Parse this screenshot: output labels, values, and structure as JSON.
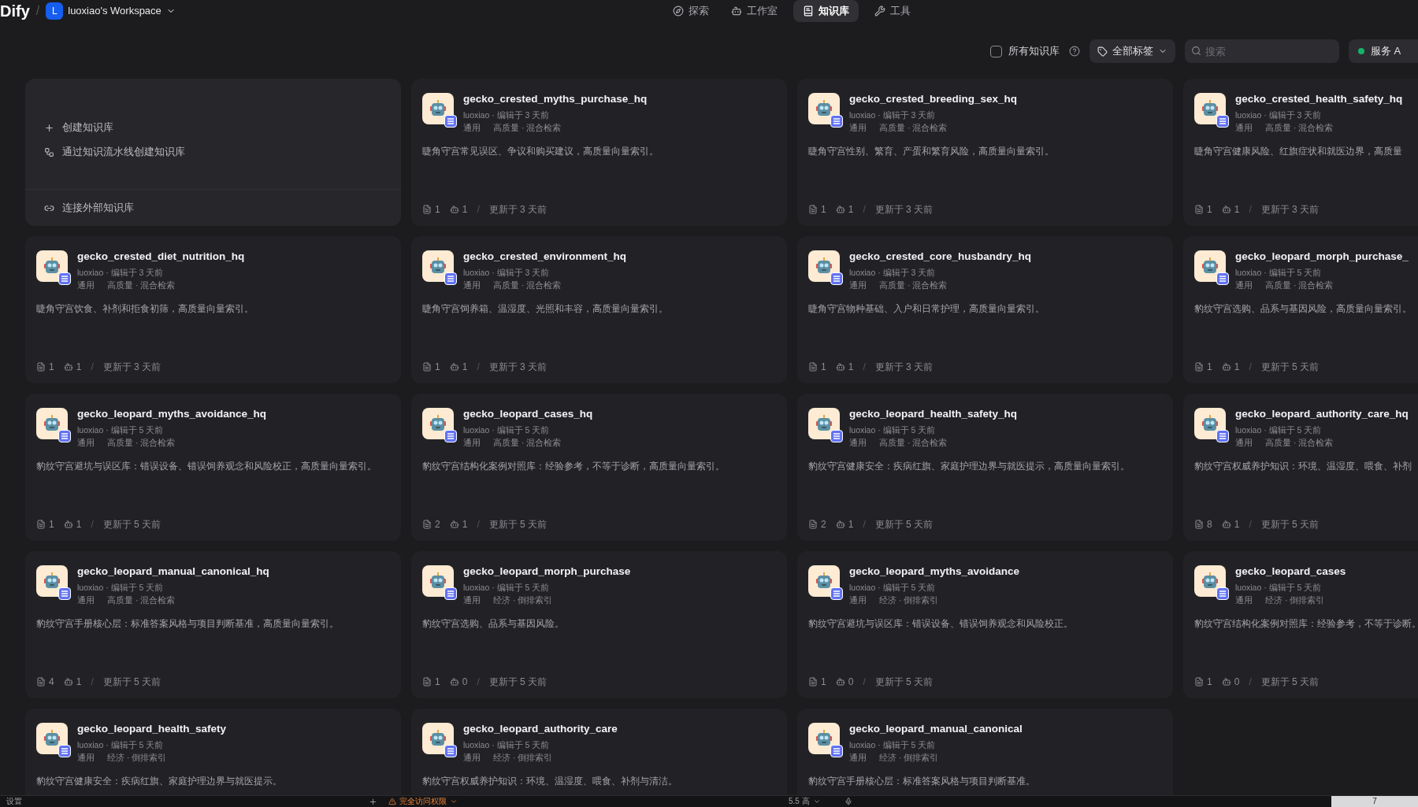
{
  "header": {
    "logo": "Dify",
    "separator": "/",
    "workspace": {
      "initial": "L",
      "name": "luoxiao's Workspace"
    },
    "nav": [
      {
        "label": "探索",
        "selected": false
      },
      {
        "label": "工作室",
        "selected": false
      },
      {
        "label": "知识库",
        "selected": true
      },
      {
        "label": "工具",
        "selected": false
      }
    ]
  },
  "toolbar": {
    "all_datasets": {
      "label": "所有知识库",
      "checked": false
    },
    "tag_filter": "全部标签",
    "search": {
      "placeholder": "搜索"
    },
    "service_button": "服务 A"
  },
  "create_card": {
    "actions": [
      "创建知识库",
      "通过知识流水线创建知识库"
    ],
    "external": "连接外部知识库"
  },
  "datasets": [
    {
      "name": "gecko_crested_myths_purchase_hq",
      "meta": "luoxiao · 编辑于 3 天前",
      "tag": "通用",
      "mode": "高质量 · 混合检索",
      "description": "睫角守宫常见误区、争议和购买建议，高质量向量索引。",
      "docs": "1",
      "apps": "1",
      "separator": "/",
      "updated": "更新于 3 天前"
    },
    {
      "name": "gecko_crested_breeding_sex_hq",
      "meta": "luoxiao · 编辑于 3 天前",
      "tag": "通用",
      "mode": "高质量 · 混合检索",
      "description": "睫角守宫性别、繁育、产蛋和繁育风险，高质量向量索引。",
      "docs": "1",
      "apps": "1",
      "separator": "/",
      "updated": "更新于 3 天前"
    },
    {
      "name": "gecko_crested_health_safety_hq",
      "meta": "luoxiao · 编辑于 3 天前",
      "tag": "通用",
      "mode": "高质量 · 混合检索",
      "description": "睫角守宫健康风险、红旗症状和就医边界，高质量",
      "docs": "1",
      "apps": "1",
      "separator": "/",
      "updated": "更新于 3 天前"
    },
    {
      "name": "gecko_crested_diet_nutrition_hq",
      "meta": "luoxiao · 编辑于 3 天前",
      "tag": "通用",
      "mode": "高质量 · 混合检索",
      "description": "睫角守宫饮食、补剂和拒食初筛，高质量向量索引。",
      "docs": "1",
      "apps": "1",
      "separator": "/",
      "updated": "更新于 3 天前"
    },
    {
      "name": "gecko_crested_environment_hq",
      "meta": "luoxiao · 编辑于 3 天前",
      "tag": "通用",
      "mode": "高质量 · 混合检索",
      "description": "睫角守宫饲养箱、温湿度、光照和丰容，高质量向量索引。",
      "docs": "1",
      "apps": "1",
      "separator": "/",
      "updated": "更新于 3 天前"
    },
    {
      "name": "gecko_crested_core_husbandry_hq",
      "meta": "luoxiao · 编辑于 3 天前",
      "tag": "通用",
      "mode": "高质量 · 混合检索",
      "description": "睫角守宫物种基础、入户和日常护理，高质量向量索引。",
      "docs": "1",
      "apps": "1",
      "separator": "/",
      "updated": "更新于 3 天前"
    },
    {
      "name": "gecko_leopard_morph_purchase_",
      "meta": "luoxiao · 编辑于 5 天前",
      "tag": "通用",
      "mode": "高质量 · 混合检索",
      "description": "豹纹守宫选购、品系与基因风险，高质量向量索引。",
      "docs": "1",
      "apps": "1",
      "separator": "/",
      "updated": "更新于 5 天前"
    },
    {
      "name": "gecko_leopard_myths_avoidance_hq",
      "meta": "luoxiao · 编辑于 5 天前",
      "tag": "通用",
      "mode": "高质量 · 混合检索",
      "description": "豹纹守宫避坑与误区库：错误设备、错误饲养观念和风险校正，高质量向量索引。",
      "docs": "1",
      "apps": "1",
      "separator": "/",
      "updated": "更新于 5 天前"
    },
    {
      "name": "gecko_leopard_cases_hq",
      "meta": "luoxiao · 编辑于 5 天前",
      "tag": "通用",
      "mode": "高质量 · 混合检索",
      "description": "豹纹守宫结构化案例对照库：经验参考，不等于诊断，高质量向量索引。",
      "docs": "2",
      "apps": "1",
      "separator": "/",
      "updated": "更新于 5 天前"
    },
    {
      "name": "gecko_leopard_health_safety_hq",
      "meta": "luoxiao · 编辑于 5 天前",
      "tag": "通用",
      "mode": "高质量 · 混合检索",
      "description": "豹纹守宫健康安全：疾病红旗、家庭护理边界与就医提示，高质量向量索引。",
      "docs": "2",
      "apps": "1",
      "separator": "/",
      "updated": "更新于 5 天前"
    },
    {
      "name": "gecko_leopard_authority_care_hq",
      "meta": "luoxiao · 编辑于 5 天前",
      "tag": "通用",
      "mode": "高质量 · 混合检索",
      "description": "豹纹守宫权威养护知识：环境、温湿度、喂食、补剂",
      "docs": "8",
      "apps": "1",
      "separator": "/",
      "updated": "更新于 5 天前"
    },
    {
      "name": "gecko_leopard_manual_canonical_hq",
      "meta": "luoxiao · 编辑于 5 天前",
      "tag": "通用",
      "mode": "高质量 · 混合检索",
      "description": "豹纹守宫手册核心层：标准答案风格与项目判断基准，高质量向量索引。",
      "docs": "4",
      "apps": "1",
      "separator": "/",
      "updated": "更新于 5 天前"
    },
    {
      "name": "gecko_leopard_morph_purchase",
      "meta": "luoxiao · 编辑于 5 天前",
      "tag": "通用",
      "mode": "经济 · 倒排索引",
      "description": "豹纹守宫选购、品系与基因风险。",
      "docs": "1",
      "apps": "0",
      "separator": "/",
      "updated": "更新于 5 天前"
    },
    {
      "name": "gecko_leopard_myths_avoidance",
      "meta": "luoxiao · 编辑于 5 天前",
      "tag": "通用",
      "mode": "经济 · 倒排索引",
      "description": "豹纹守宫避坑与误区库：错误设备、错误饲养观念和风险校正。",
      "docs": "1",
      "apps": "0",
      "separator": "/",
      "updated": "更新于 5 天前"
    },
    {
      "name": "gecko_leopard_cases",
      "meta": "luoxiao · 编辑于 5 天前",
      "tag": "通用",
      "mode": "经济 · 倒排索引",
      "description": "豹纹守宫结构化案例对照库：经验参考，不等于诊断。",
      "docs": "1",
      "apps": "0",
      "separator": "/",
      "updated": "更新于 5 天前"
    },
    {
      "name": "gecko_leopard_health_safety",
      "meta": "luoxiao · 编辑于 5 天前",
      "tag": "通用",
      "mode": "经济 · 倒排索引",
      "description": "豹纹守宫健康安全：疾病红旗、家庭护理边界与就医提示。"
    },
    {
      "name": "gecko_leopard_authority_care",
      "meta": "luoxiao · 编辑于 5 天前",
      "tag": "通用",
      "mode": "经济 · 倒排索引",
      "description": "豹纹守宫权威养护知识：环境、温湿度、喂食、补剂与清洁。"
    },
    {
      "name": "gecko_leopard_manual_canonical",
      "meta": "luoxiao · 编辑于 5 天前",
      "tag": "通用",
      "mode": "经济 · 倒排索引",
      "description": "豹纹守宫手册核心层：标准答案风格与项目判断基准。"
    }
  ],
  "bottom_bar": {
    "settings": "设置",
    "access": "完全访问权限",
    "model": "5.5 高",
    "count": "7"
  }
}
